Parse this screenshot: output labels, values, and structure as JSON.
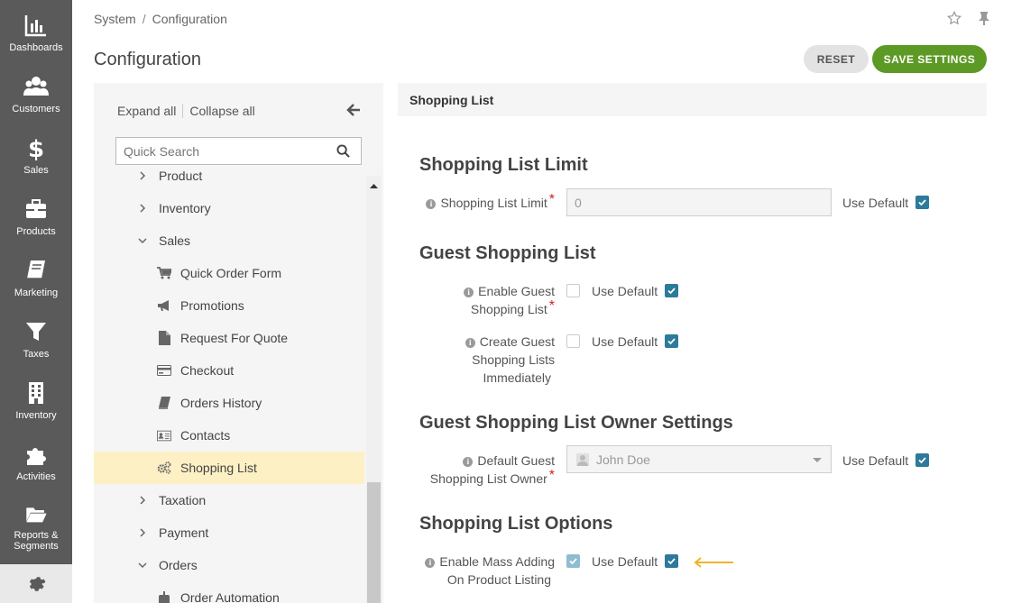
{
  "nav": {
    "items": [
      {
        "label": "Dashboards",
        "icon": "bar-chart-icon"
      },
      {
        "label": "Customers",
        "icon": "users-icon"
      },
      {
        "label": "Sales",
        "icon": "dollar-icon"
      },
      {
        "label": "Products",
        "icon": "briefcase-icon"
      },
      {
        "label": "Marketing",
        "icon": "book-icon"
      },
      {
        "label": "Taxes",
        "icon": "filter-icon"
      },
      {
        "label": "Inventory",
        "icon": "building-icon"
      },
      {
        "label": "Activities",
        "icon": "puzzle-icon"
      },
      {
        "label": "Reports &",
        "label2": "Segments",
        "icon": "folder-icon"
      }
    ],
    "bottom_icon": "gear-icon"
  },
  "breadcrumb": {
    "items": [
      "System",
      "Configuration"
    ],
    "separator": "/"
  },
  "header": {
    "title": "Configuration",
    "reset_label": "RESET",
    "save_label": "SAVE SETTINGS"
  },
  "tree": {
    "expand_all": "Expand all",
    "collapse_all": "Collapse all",
    "search_placeholder": "Quick Search",
    "rows": [
      {
        "label": "Product",
        "level": 0,
        "expander": "collapsed"
      },
      {
        "label": "Inventory",
        "level": 0,
        "expander": "collapsed"
      },
      {
        "label": "Sales",
        "level": 0,
        "expander": "expanded"
      },
      {
        "label": "Quick Order Form",
        "level": 1,
        "icon": "cart-icon"
      },
      {
        "label": "Promotions",
        "level": 1,
        "icon": "megaphone-icon"
      },
      {
        "label": "Request For Quote",
        "level": 1,
        "icon": "file-icon"
      },
      {
        "label": "Checkout",
        "level": 1,
        "icon": "credit-card-icon"
      },
      {
        "label": "Orders History",
        "level": 1,
        "icon": "book-icon"
      },
      {
        "label": "Contacts",
        "level": 1,
        "icon": "contact-card-icon"
      },
      {
        "label": "Shopping List",
        "level": 1,
        "icon": "cogs-icon",
        "selected": true
      },
      {
        "label": "Taxation",
        "level": 0,
        "expander": "collapsed"
      },
      {
        "label": "Payment",
        "level": 0,
        "expander": "collapsed"
      },
      {
        "label": "Orders",
        "level": 0,
        "expander": "expanded"
      },
      {
        "label": "Order Automation",
        "level": 1,
        "icon": "robot-icon"
      }
    ]
  },
  "content": {
    "section_title": "Shopping List",
    "groups": {
      "limit": {
        "title": "Shopping List Limit",
        "field_label": "Shopping List Limit",
        "value": "0",
        "use_default": "Use Default"
      },
      "guest": {
        "title": "Guest Shopping List",
        "enable_label_1": "Enable Guest",
        "enable_label_2": "Shopping List",
        "create_label_1": "Create Guest",
        "create_label_2": "Shopping Lists",
        "create_label_3": "Immediately",
        "use_default": "Use Default"
      },
      "owner": {
        "title": "Guest Shopping List Owner Settings",
        "label_1": "Default Guest",
        "label_2": "Shopping List Owner",
        "value": "John Doe",
        "use_default": "Use Default"
      },
      "options": {
        "title": "Shopping List Options",
        "label_1": "Enable Mass Adding",
        "label_2": "On Product Listing",
        "use_default": "Use Default"
      }
    }
  },
  "colors": {
    "accent": "#5d9a25",
    "checkbox": "#2d7a9a",
    "selected_row": "#fdf0c4",
    "annotation_arrow": "#f0b429"
  }
}
